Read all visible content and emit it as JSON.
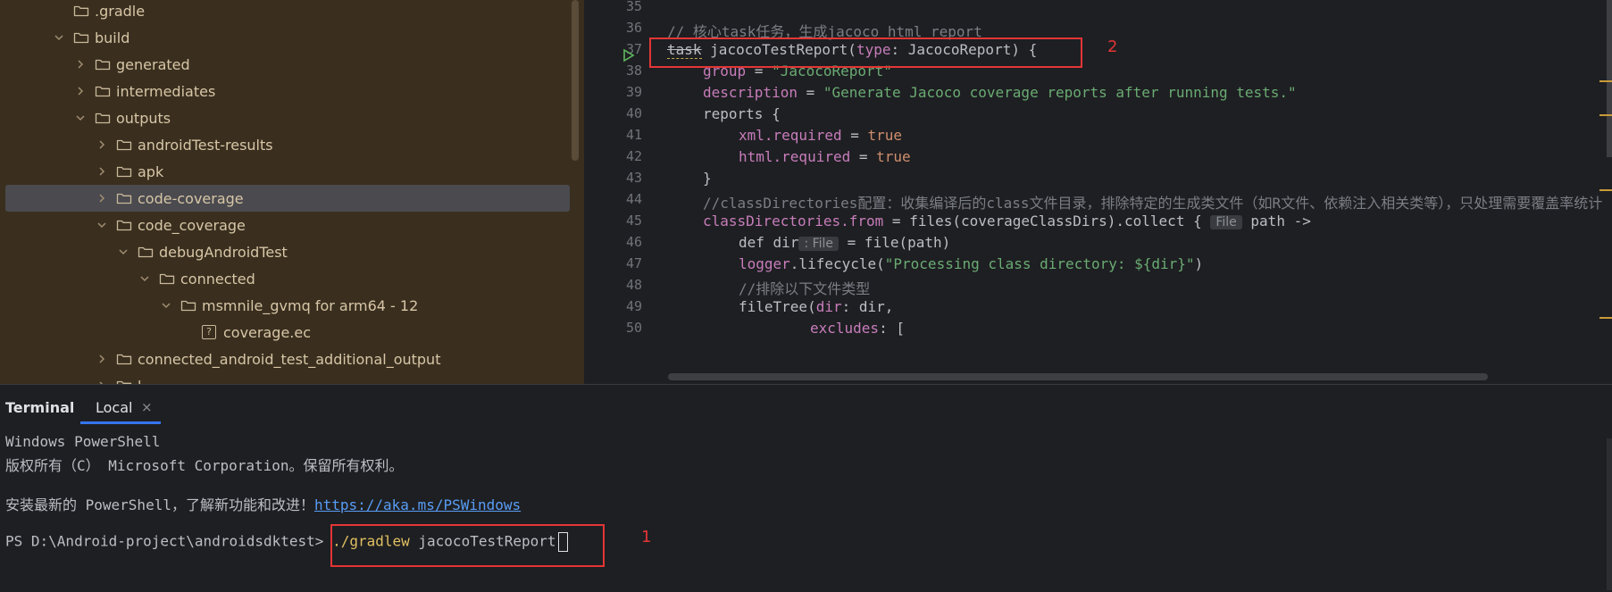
{
  "project_tree": {
    "items": [
      {
        "label": ".gradle",
        "indent": 0,
        "chevron": "none",
        "icon": "folder"
      },
      {
        "label": "build",
        "indent": 0,
        "chevron": "down",
        "icon": "folder"
      },
      {
        "label": "generated",
        "indent": 1,
        "chevron": "right",
        "icon": "folder"
      },
      {
        "label": "intermediates",
        "indent": 1,
        "chevron": "right",
        "icon": "folder"
      },
      {
        "label": "outputs",
        "indent": 1,
        "chevron": "down",
        "icon": "folder"
      },
      {
        "label": "androidTest-results",
        "indent": 2,
        "chevron": "right",
        "icon": "folder"
      },
      {
        "label": "apk",
        "indent": 2,
        "chevron": "right",
        "icon": "folder"
      },
      {
        "label": "code-coverage",
        "indent": 2,
        "chevron": "right",
        "icon": "folder",
        "selected": true
      },
      {
        "label": "code_coverage",
        "indent": 2,
        "chevron": "down",
        "icon": "folder"
      },
      {
        "label": "debugAndroidTest",
        "indent": 3,
        "chevron": "down",
        "icon": "folder"
      },
      {
        "label": "connected",
        "indent": 4,
        "chevron": "down",
        "icon": "folder"
      },
      {
        "label": "msmnile_gvmq for arm64 - 12",
        "indent": 5,
        "chevron": "down",
        "icon": "folder"
      },
      {
        "label": "coverage.ec",
        "indent": 6,
        "chevron": "none",
        "icon": "unknown-file"
      },
      {
        "label": "connected_android_test_additional_output",
        "indent": 2,
        "chevron": "right",
        "icon": "folder"
      },
      {
        "label": "l",
        "indent": 2,
        "chevron": "right",
        "icon": "folder"
      }
    ]
  },
  "editor": {
    "line_numbers": [
      "35",
      "36",
      "37",
      "38",
      "39",
      "40",
      "41",
      "42",
      "43",
      "44",
      "45",
      "46",
      "47",
      "48",
      "49",
      "50"
    ],
    "lines": {
      "l36": "// 核心task任务，生成jacoco html report",
      "l37_task": "task",
      "l37_rest_fn": "jacocoTestReport",
      "l37_rest_type": "type",
      "l37_rest_tail": ": JacocoReport) {",
      "l38_key": "group",
      "l38_val": "\"JacocoReport\"",
      "l39_key": "description",
      "l39_val": "\"Generate Jacoco coverage reports after running tests.\"",
      "l40": "reports {",
      "l41_key": "xml.required",
      "l41_val": "true",
      "l42_key": "html.required",
      "l42_val": "true",
      "l43": "}",
      "l44": "//classDirectories配置：收集编译后的class文件目录，排除特定的生成类文件（如R文件、依赖注入相关类等），只处理需要覆盖率统计",
      "l45_a": "classDirectories.from",
      "l45_b": " = files(coverageClassDirs).collect { ",
      "l45_hint": "File",
      "l45_c": " path ->",
      "l46_a": "def dir",
      "l46_hint": ": File",
      "l46_b": " = file(path)",
      "l47_a": "logger",
      "l47_b": ".lifecycle(",
      "l47_str": "\"Processing class directory: ${dir}\"",
      "l47_c": ")",
      "l48": "//排除以下文件类型",
      "l49_a": "fileTree(",
      "l49_b": "dir",
      "l49_c": ": dir,",
      "l50_a": "excludes",
      "l50_b": ": ["
    },
    "annotation_2": "2"
  },
  "terminal": {
    "title": "Terminal",
    "tab_label": "Local",
    "tab_close": "×",
    "lines": {
      "t1": "Windows PowerShell",
      "t2": "版权所有（C） Microsoft Corporation。保留所有权利。",
      "t3_prefix": "安装最新的 PowerShell，了解新功能和改进！",
      "t3_link": "https://aka.ms/PSWindows",
      "t4_prompt": "PS D:\\Android-project\\androidsdktest>",
      "t4_cmd": "./gradlew",
      "t4_arg": " jacocoTestReport"
    },
    "annotation_1": "1"
  },
  "colors": {
    "highlight_red": "#e43535",
    "tree_bg": "#3a2f1f",
    "editor_bg": "#1e1f22"
  }
}
